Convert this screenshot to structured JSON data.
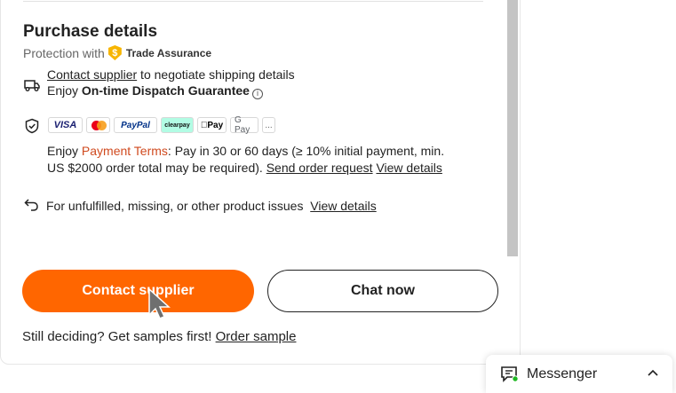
{
  "purchase": {
    "title": "Purchase details",
    "protection_prefix": "Protection with",
    "trade_assurance": "Trade Assurance",
    "trade_assurance_badge": "$"
  },
  "shipping": {
    "contact_link": "Contact supplier",
    "negotiate_text": " to negotiate shipping details",
    "enjoy_prefix": "Enjoy ",
    "guarantee": "On-time Dispatch Guarantee",
    "info_icon": "i"
  },
  "payment": {
    "logos": [
      "VISA",
      "",
      "PayPal",
      "clearpay",
      "Pay",
      "G Pay",
      "..."
    ],
    "enjoy_prefix": "Enjoy ",
    "terms_link": "Payment Terms",
    "terms_text": ": Pay in 30 or 60 days (≥ 10% initial payment, min.",
    "line2_text": "US $2000 order total may be required). ",
    "send_request_link": "Send order request",
    "view_details_link": "View details"
  },
  "returns": {
    "text": "For unfulfilled, missing, or other product issues",
    "view_details_link": "View details"
  },
  "actions": {
    "contact_button": "Contact supplier",
    "chat_button": "Chat now",
    "samples_text": "Still deciding? Get samples first! ",
    "order_sample_link": "Order sample"
  },
  "messenger": {
    "label": "Messenger",
    "status_color": "#1fb823"
  },
  "colors": {
    "accent": "#ff6600",
    "link_orange": "#d04a1f",
    "trade_assurance_gold": "#f7b500"
  }
}
